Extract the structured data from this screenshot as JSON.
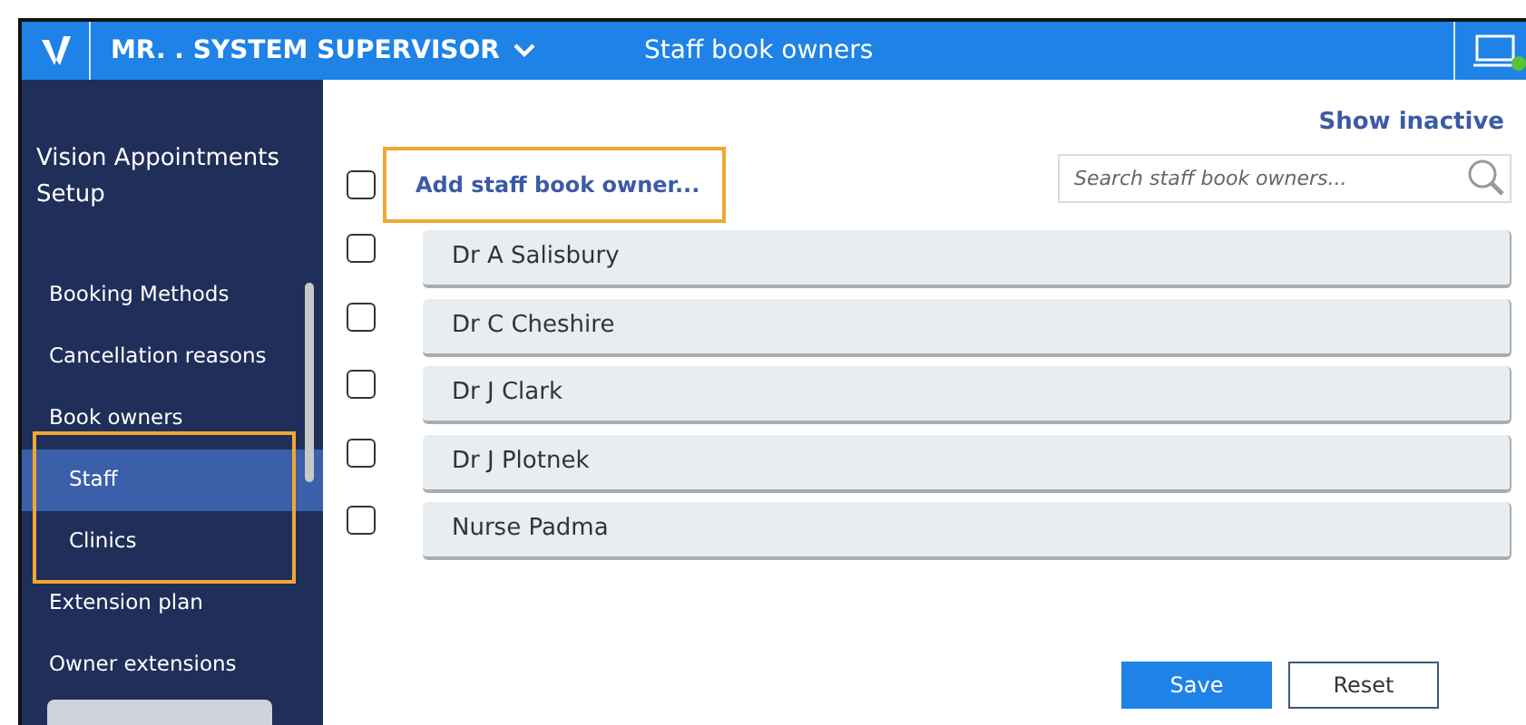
{
  "header": {
    "user": "MR. . SYSTEM SUPERVISOR",
    "title": "Staff book owners"
  },
  "sidebar": {
    "title": "Vision Appointments Setup",
    "items": [
      {
        "label": "Booking Methods",
        "selected": false
      },
      {
        "label": "Cancellation reasons",
        "selected": false
      },
      {
        "label": "Book owners",
        "selected": false,
        "children": [
          {
            "label": "Staff",
            "selected": true,
            "highlighted": true
          },
          {
            "label": "Clinics",
            "selected": false,
            "highlighted": true
          }
        ]
      },
      {
        "label": "Extension plan",
        "selected": false
      },
      {
        "label": "Owner extensions",
        "selected": false
      }
    ]
  },
  "show_inactive": "Show inactive",
  "select_all": {
    "checked": false
  },
  "add_link": {
    "label": "Add staff book owner...",
    "highlighted": true
  },
  "search": {
    "placeholder": "Search staff book owners..."
  },
  "owners": [
    {
      "name": "Dr A Salisbury",
      "checked": false
    },
    {
      "name": "Dr C Cheshire",
      "checked": false
    },
    {
      "name": "Dr J Clark",
      "checked": false
    },
    {
      "name": "Dr J Plotnek",
      "checked": false
    },
    {
      "name": "Nurse Padma",
      "checked": false
    }
  ],
  "buttons": [
    {
      "label": "Save",
      "kind": "primary"
    },
    {
      "label": "Reset",
      "kind": "secondary"
    }
  ]
}
